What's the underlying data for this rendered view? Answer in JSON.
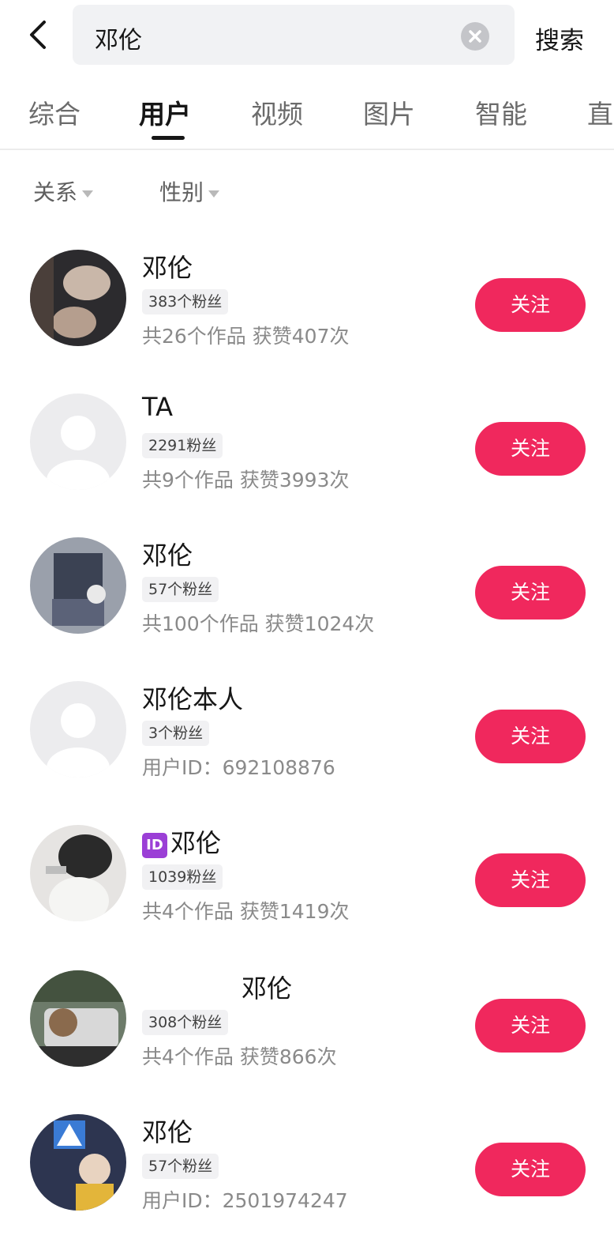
{
  "search": {
    "query": "邓伦",
    "submit_label": "搜索",
    "back_icon": "back-chevron-icon",
    "clear_icon": "clear-circle-icon"
  },
  "tabs": [
    {
      "label": "综合",
      "active": false
    },
    {
      "label": "用户",
      "active": true
    },
    {
      "label": "视频",
      "active": false
    },
    {
      "label": "图片",
      "active": false
    },
    {
      "label": "智能",
      "active": false
    },
    {
      "label": "直",
      "active": false
    }
  ],
  "filters": [
    {
      "label": "关系"
    },
    {
      "label": "性别"
    }
  ],
  "accent_color": "#f0285d",
  "users": [
    {
      "name": "邓伦",
      "fans": "383个粉丝",
      "stats": "共26个作品 获赞407次",
      "follow_label": "关注"
    },
    {
      "name": "TA",
      "fans": "2291粉丝",
      "stats": "共9个作品 获赞3993次",
      "follow_label": "关注"
    },
    {
      "name": "邓伦",
      "fans": "57个粉丝",
      "stats": "共100个作品 获赞1024次",
      "follow_label": "关注"
    },
    {
      "name": "邓伦本人",
      "fans": "3个粉丝",
      "stats": "用户ID：692108876",
      "follow_label": "关注"
    },
    {
      "name_icon": "ID",
      "name": "邓伦",
      "fans": "1039粉丝",
      "stats": "共4个作品 获赞1419次",
      "follow_label": "关注"
    },
    {
      "name": "邓伦",
      "fans": "308个粉丝",
      "stats": "共4个作品 获赞866次",
      "follow_label": "关注"
    },
    {
      "name": "邓伦",
      "fans": "57个粉丝",
      "stats": "用户ID：2501974247",
      "follow_label": "关注"
    }
  ]
}
